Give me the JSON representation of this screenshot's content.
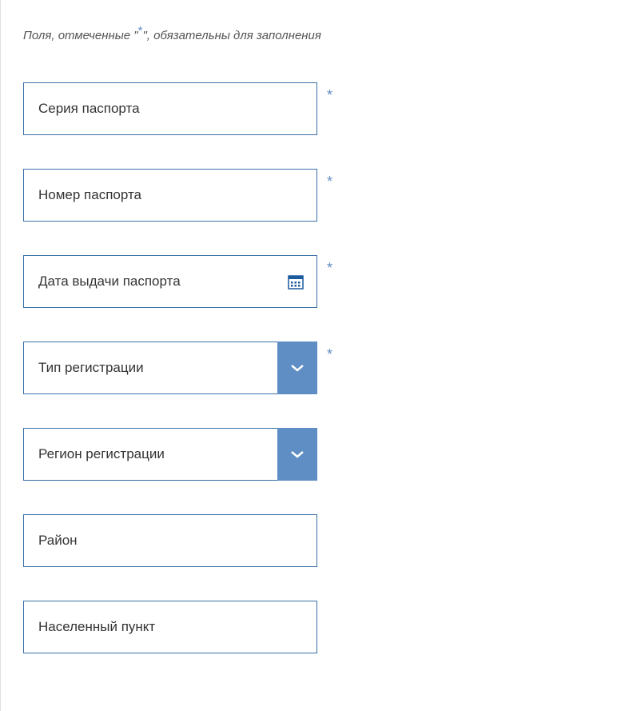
{
  "note": {
    "prefix": "Поля, отмеченные \"",
    "star": "*",
    "suffix": "\", обязательны для заполнения"
  },
  "fields": {
    "passportSeries": {
      "label": "Серия паспорта",
      "required": true
    },
    "passportNumber": {
      "label": "Номер паспорта",
      "required": true
    },
    "passportIssueDate": {
      "label": "Дата выдачи паспорта",
      "required": true
    },
    "registrationType": {
      "label": "Тип регистрации",
      "required": true
    },
    "registrationRegion": {
      "label": "Регион регистрации",
      "required": false
    },
    "district": {
      "label": "Район",
      "required": false
    },
    "locality": {
      "label": "Населенный пункт",
      "required": false
    }
  }
}
